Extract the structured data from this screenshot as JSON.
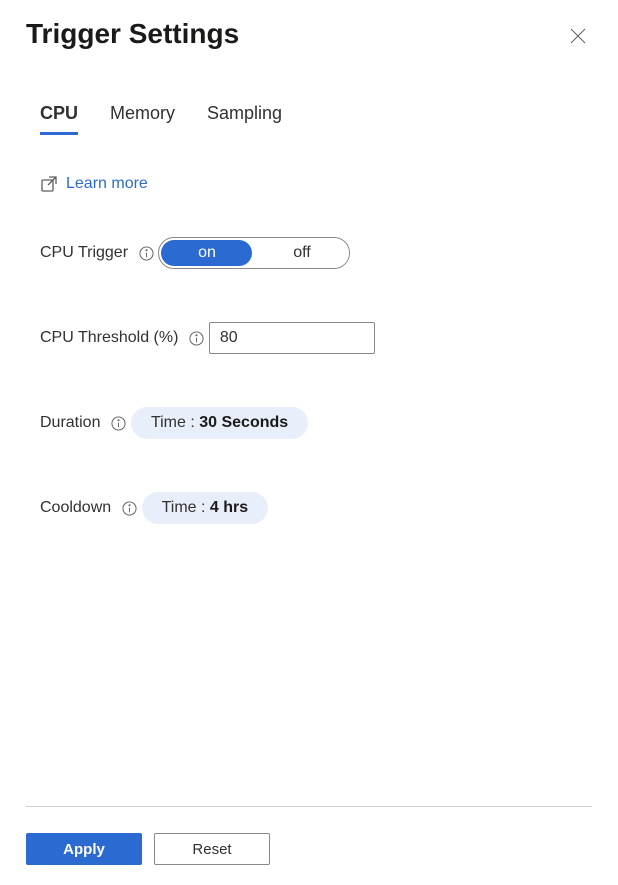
{
  "header": {
    "title": "Trigger Settings"
  },
  "tabs": [
    {
      "label": "CPU",
      "active": true
    },
    {
      "label": "Memory",
      "active": false
    },
    {
      "label": "Sampling",
      "active": false
    }
  ],
  "learn_more": {
    "label": "Learn more"
  },
  "cpu_trigger": {
    "label": "CPU Trigger",
    "on_label": "on",
    "off_label": "off",
    "value": "on"
  },
  "cpu_threshold": {
    "label": "CPU Threshold (%)",
    "value": "80"
  },
  "duration": {
    "label": "Duration",
    "prefix": "Time : ",
    "value": "30 Seconds"
  },
  "cooldown": {
    "label": "Cooldown",
    "prefix": "Time : ",
    "value": "4 hrs"
  },
  "footer": {
    "apply_label": "Apply",
    "reset_label": "Reset"
  }
}
